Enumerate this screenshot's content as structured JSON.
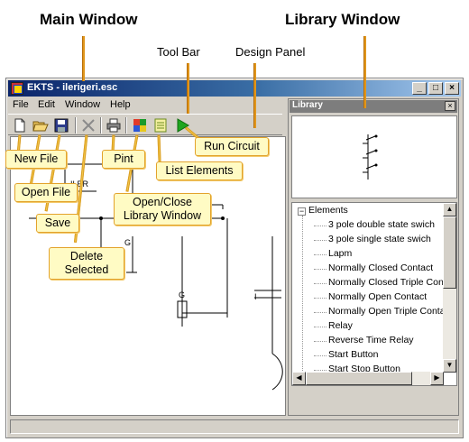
{
  "header_labels": {
    "main_window": "Main Window",
    "tool_bar": "Tool Bar",
    "design_panel": "Design Panel",
    "library_window": "Library Window"
  },
  "window": {
    "title": "EKTS - ilerigeri.esc",
    "minimize": "_",
    "maximize": "□",
    "close": "×"
  },
  "menu": [
    "File",
    "Edit",
    "Window",
    "Help"
  ],
  "toolbar": {
    "icons": [
      "new-file-icon",
      "open-folder-icon",
      "save-disk-icon",
      "delete-x-icon",
      "printer-icon",
      "library-toggle-icon",
      "list-elements-icon",
      "run-play-icon"
    ]
  },
  "design": {
    "labels": [
      "ILER",
      "GE",
      "G",
      "G",
      "I"
    ]
  },
  "library": {
    "title": "Library",
    "close": "×",
    "tree_root": "Elements",
    "expander": "−",
    "items": [
      "3 pole double state swich",
      "3 pole single state swich",
      "Lapm",
      "Normally Closed Contact",
      "Normally Closed Triple Cont",
      "Normally Open Contact",
      "Normally Open Triple Conta",
      "Relay",
      "Reverse Time Relay",
      "Start Button",
      "Start Stop Button",
      "Stop Button"
    ]
  },
  "callouts": {
    "new_file": "New File",
    "open_file": "Open File",
    "save": "Save",
    "delete_line1": "Delete",
    "delete_line2": "Selected",
    "print": "Pint",
    "library_line1": "Open/Close",
    "library_line2": "Library Window",
    "list_elements": "List Elements",
    "run_circuit": "Run Circuit"
  },
  "colors": {
    "callout_fill": "#fffbc4",
    "callout_border": "#e3a32c",
    "titlebar_start": "#0a246a",
    "titlebar_end": "#a6caf0",
    "run_green": "#1fa51f"
  }
}
